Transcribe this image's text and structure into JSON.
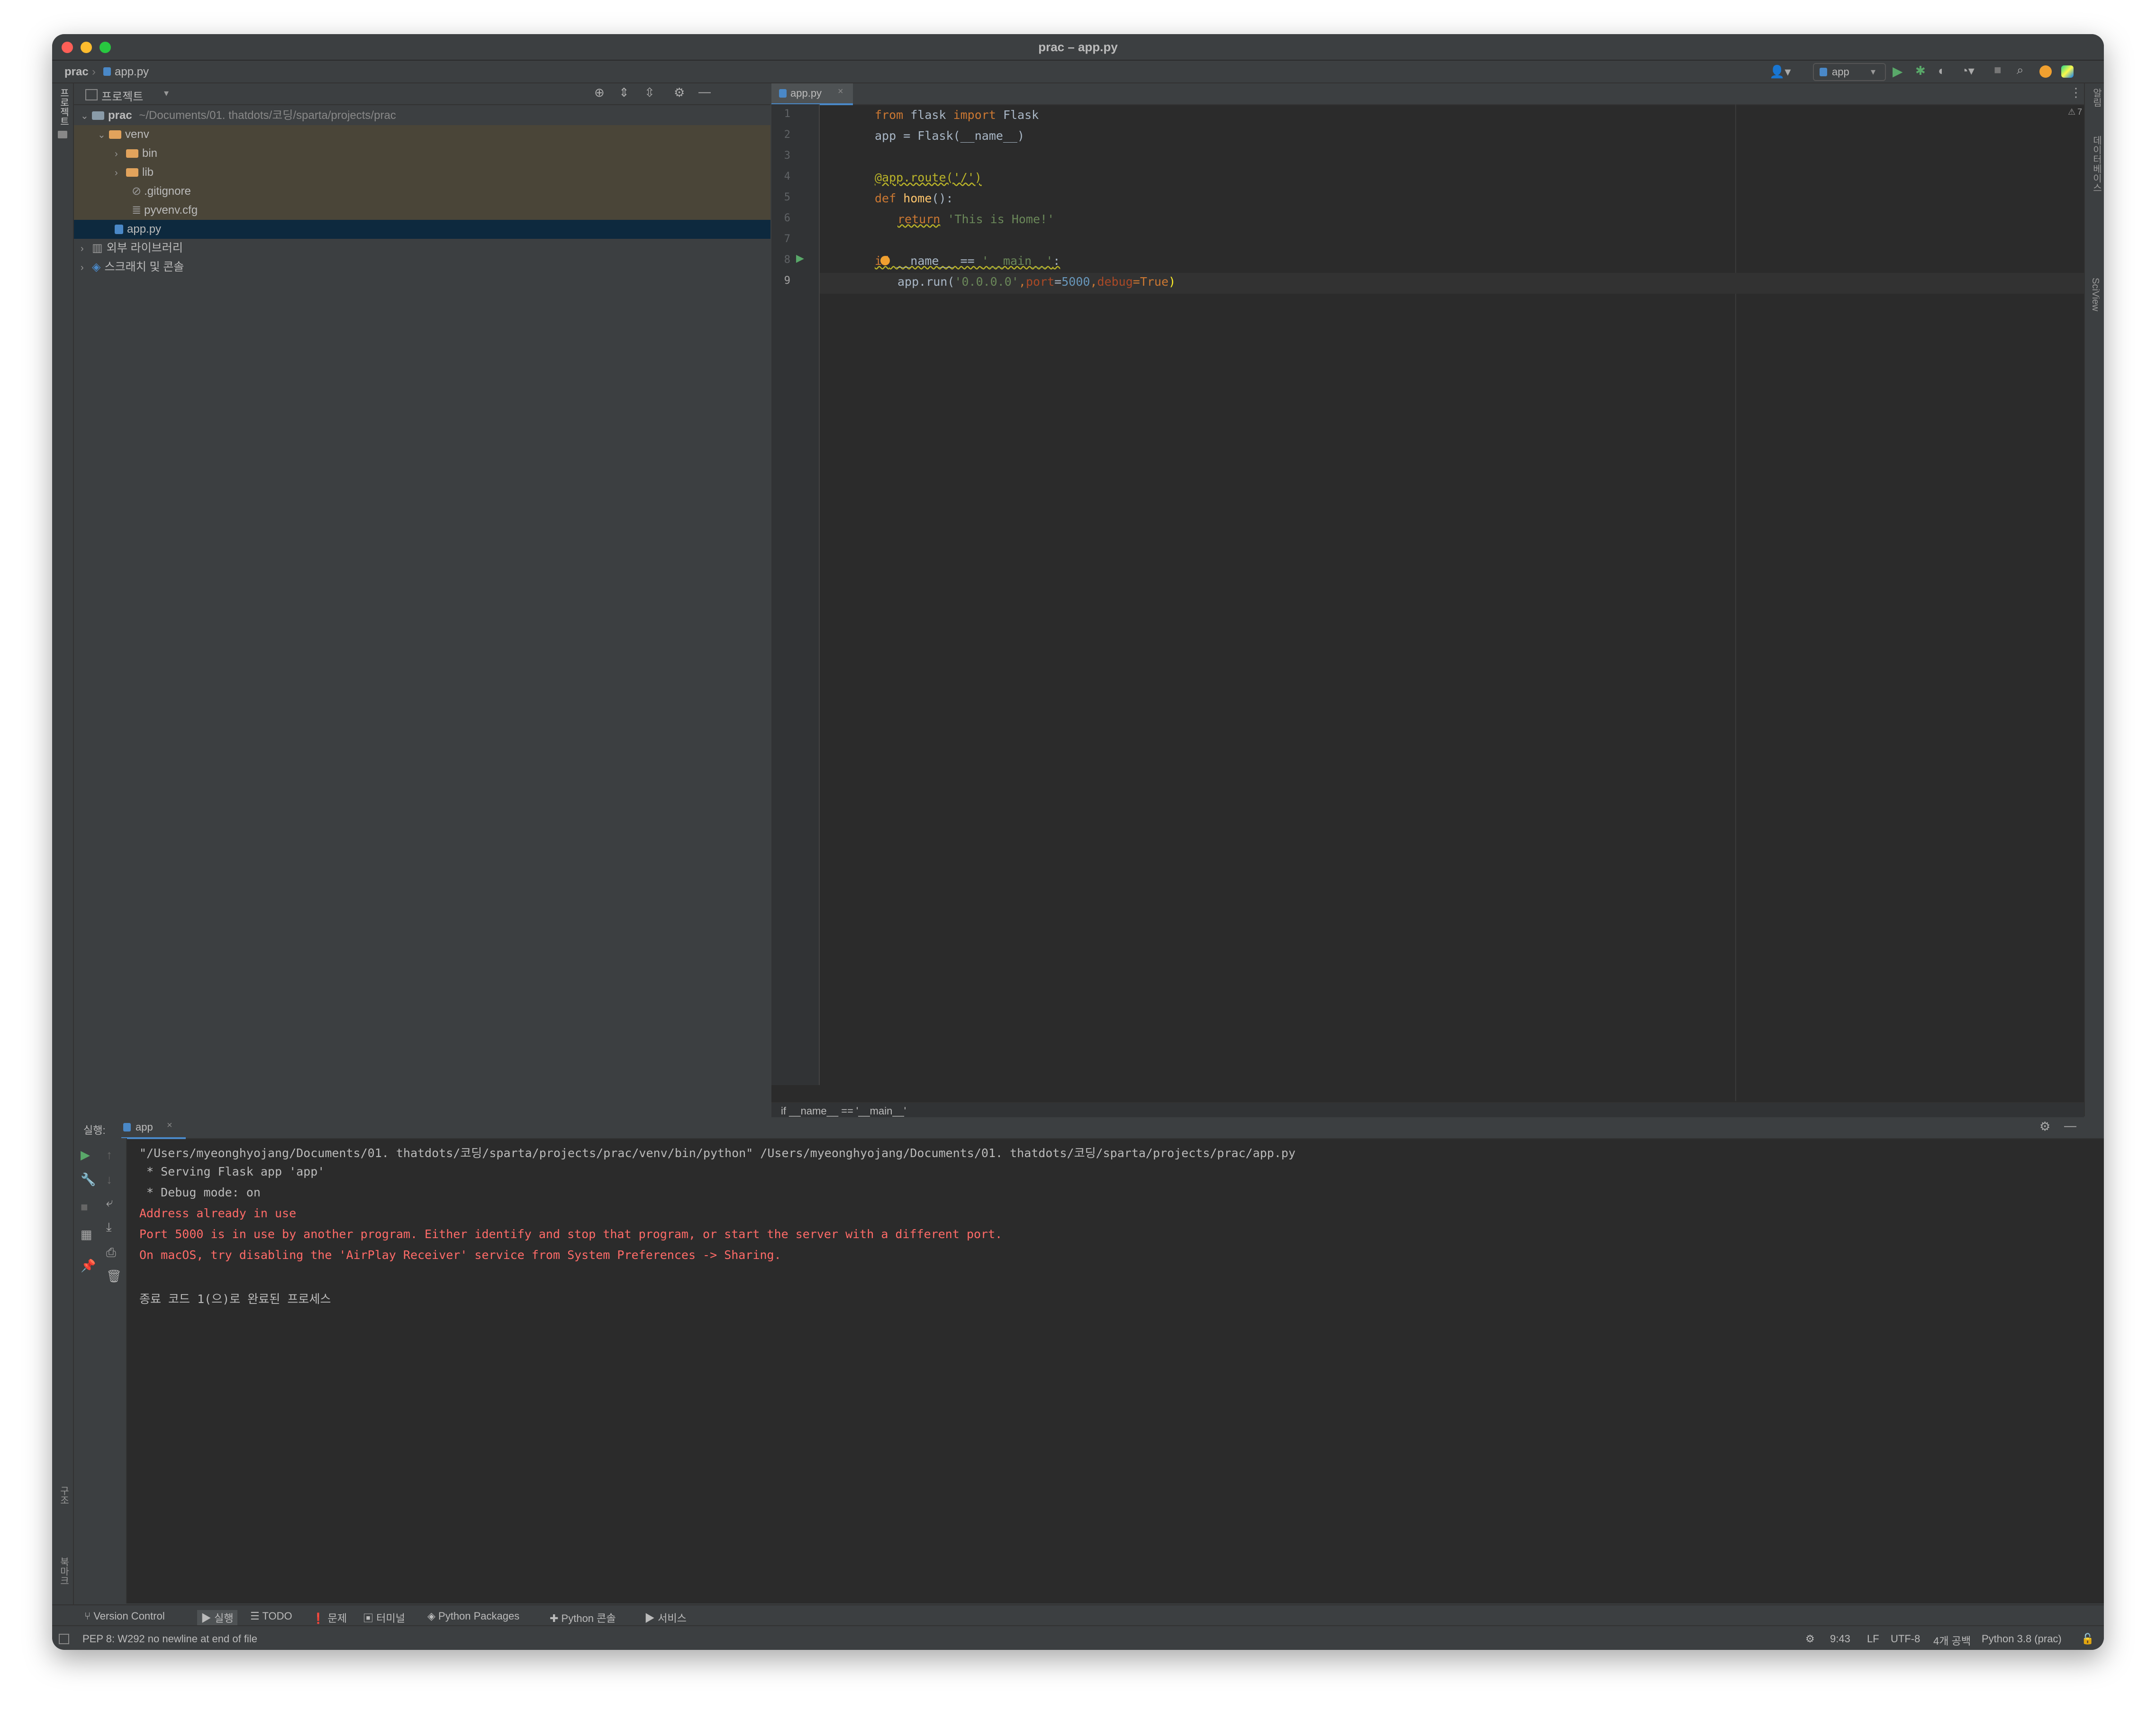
{
  "window": {
    "title": "prac – app.py"
  },
  "nav": {
    "project": "prac",
    "file": "app.py",
    "run_config": "app"
  },
  "side_left": {
    "project_tool": "프로젝트",
    "structure_tool": "구조",
    "bookmarks_tool": "북마크"
  },
  "side_right": {
    "notifications": "알림",
    "database": "데이터베이스",
    "sciview": "SciView"
  },
  "project_panel": {
    "header": "프로젝트",
    "tree": [
      {
        "name": "prac",
        "extra": "~/Documents/01. thatdots/코딩/sparta/projects/prac"
      },
      {
        "name": "venv"
      },
      {
        "name": "bin"
      },
      {
        "name": "lib"
      },
      {
        "name": ".gitignore"
      },
      {
        "name": "pyvenv.cfg"
      },
      {
        "name": "app.py"
      },
      {
        "name": "외부 라이브러리"
      },
      {
        "name": "스크래치 및 콘솔"
      }
    ]
  },
  "editor": {
    "tab": "app.py",
    "warnings": "7",
    "line_numbers": [
      "1",
      "2",
      "3",
      "4",
      "5",
      "6",
      "7",
      "8",
      "9"
    ],
    "code": {
      "l1": {
        "kw1": "from",
        "mod": " flask ",
        "kw2": "import",
        "name": " Flask"
      },
      "l2": "app = Flask(__name__)",
      "l4": "@app.route('/')",
      "l5": {
        "kw": "def",
        "fn": " home",
        "rest": "():"
      },
      "l6": {
        "kw": "return",
        "str": " 'This is Home!'"
      },
      "l8": {
        "kw": "if",
        "rest": " __name__ == ",
        "str": "'__main__'",
        "end": ":"
      },
      "l9": {
        "a": "app.run(",
        "s": "'0.0.0.0'",
        "c1": ",",
        "p1": "port",
        "eq1": "=",
        "n": "5000",
        "c2": ",",
        "p2": "debug",
        "eq2": "=True",
        "close": ")"
      }
    },
    "breadcrumb": "if __name__ == '__main__'"
  },
  "run": {
    "label": "실행:",
    "tab": "app",
    "lines": [
      "\"/Users/myeonghyojang/Documents/01. thatdots/코딩/sparta/projects/prac/venv/bin/python\" /Users/myeonghyojang/Documents/01. thatdots/코딩/sparta/projects/prac/app.py",
      " * Serving Flask app 'app'",
      " * Debug mode: on"
    ],
    "errors": [
      "Address already in use",
      "Port 5000 is in use by another program. Either identify and stop that program, or start the server with a different port.",
      "On macOS, try disabling the 'AirPlay Receiver' service from System Preferences -> Sharing."
    ],
    "exit": "종료 코드 1(으)로 완료된 프로세스"
  },
  "bottom_tabs": [
    "Version Control",
    "실행",
    "TODO",
    "문제",
    "터미널",
    "Python Packages",
    "Python 콘솔",
    "서비스"
  ],
  "status": {
    "message": "PEP 8: W292 no newline at end of file",
    "position": "9:43",
    "line_sep": "LF",
    "encoding": "UTF-8",
    "indent": "4개 공백",
    "interpreter": "Python 3.8 (prac)"
  },
  "colors": {
    "accent": "#4a88c7",
    "error": "#ff6b68",
    "folder": "#e2a35c",
    "selection": "#0d293e",
    "excluded_bg": "#4a4538"
  }
}
